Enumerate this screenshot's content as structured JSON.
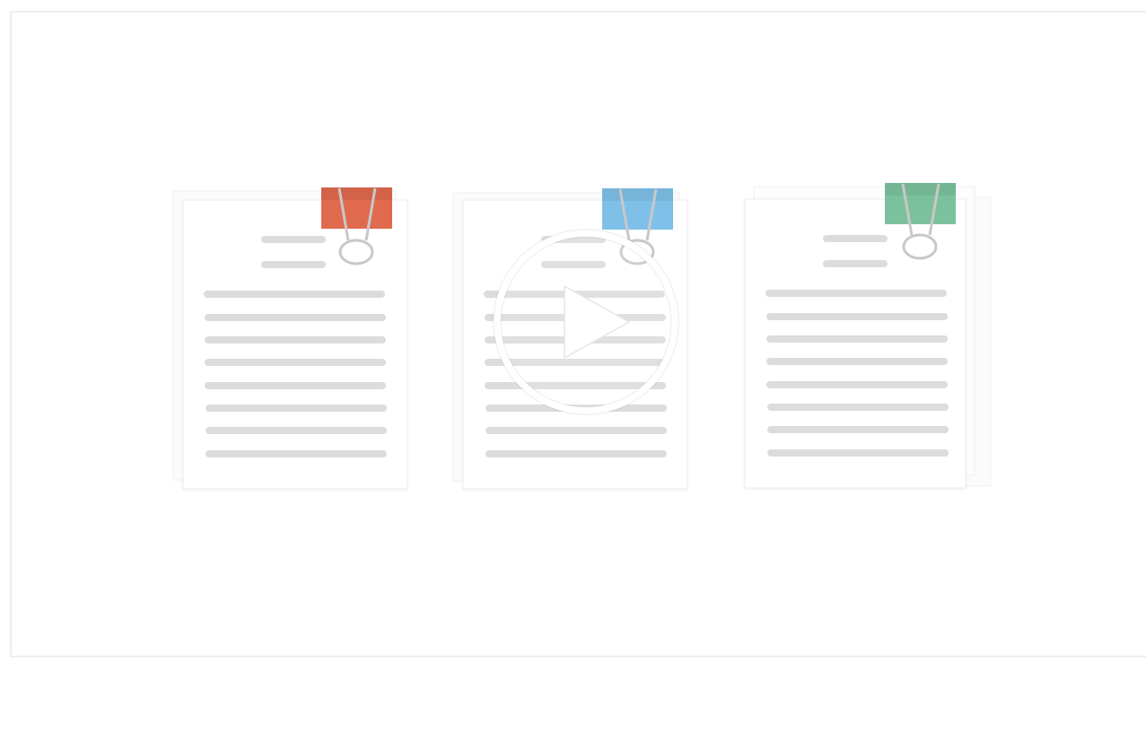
{
  "video_player": {
    "state": "paused",
    "overlay_icon": "play-icon"
  },
  "documents": [
    {
      "name": "document-red",
      "clip_color": "#e06a4e"
    },
    {
      "name": "document-blue",
      "clip_color": "#7fc0e8"
    },
    {
      "name": "document-green",
      "clip_color": "#7cc19e"
    }
  ],
  "colors": {
    "paper": "#ffffff",
    "paper_border": "#ececec",
    "text_line": "#dcdcdc",
    "clip_wire": "#c8c8c8",
    "play_overlay": "#ffffff"
  }
}
